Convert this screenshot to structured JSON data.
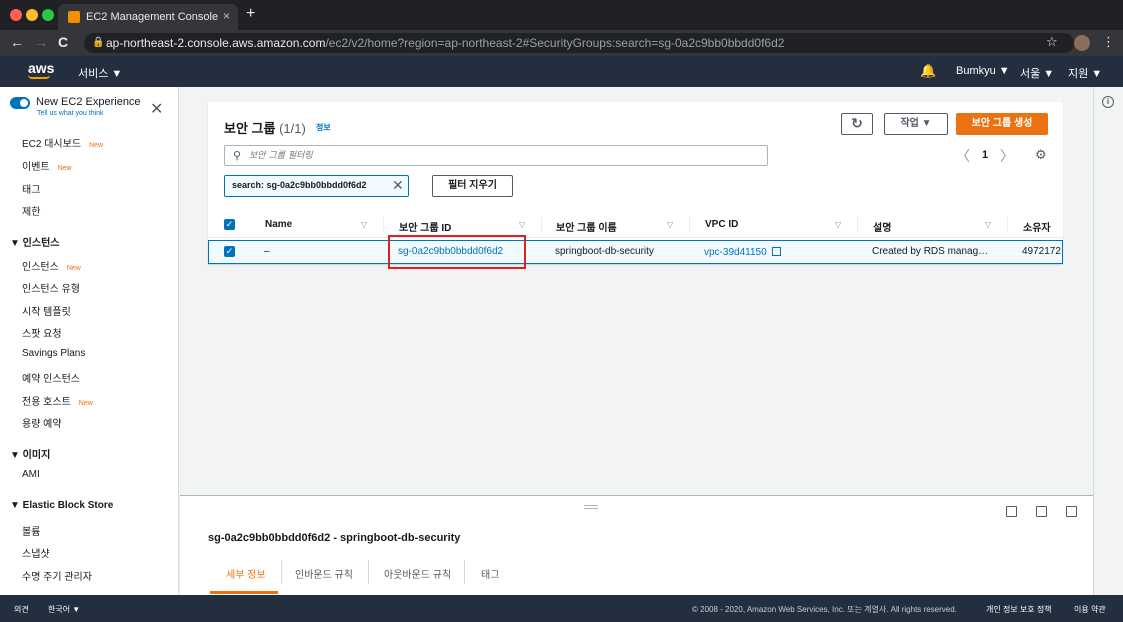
{
  "browser": {
    "tab_title": "EC2 Management Console",
    "tab_close": "×",
    "new_tab": "+",
    "url_host": "ap-northeast-2.console.aws.amazon.com",
    "url_path": "/ec2/v2/home?region=ap-northeast-2#SecurityGroups:search=sg-0a2c9bb0bbdd0f6d2",
    "back": "←",
    "forward": "→",
    "reload": "C",
    "lock": "🔒",
    "star": "☆",
    "menu": "⋮"
  },
  "topnav": {
    "logo": "aws",
    "services": "서비스 ▼",
    "bell": "🔔",
    "user": "Bumkyu ▼",
    "region": "서울 ▼",
    "support": "지원 ▼"
  },
  "sidebar": {
    "new_experience": "New EC2 Experience",
    "tell_us": "Tell us what you think",
    "close": "✕",
    "items": [
      {
        "label": "EC2 대시보드",
        "new": "New"
      },
      {
        "label": "이벤트",
        "new": "New"
      },
      {
        "label": "태그",
        "new": ""
      },
      {
        "label": "제한",
        "new": ""
      }
    ],
    "section_instances": "▼  인스턴스",
    "instances_items": [
      {
        "label": "인스턴스",
        "new": "New"
      },
      {
        "label": "인스턴스 유형",
        "new": ""
      },
      {
        "label": "시작 템플릿",
        "new": ""
      },
      {
        "label": "스팟 요청",
        "new": ""
      },
      {
        "label": "Savings Plans",
        "new": ""
      },
      {
        "label": "예약 인스턴스",
        "new": ""
      },
      {
        "label": "전용 호스트",
        "new": "New"
      },
      {
        "label": "용량 예약",
        "new": ""
      }
    ],
    "section_images": "▼  이미지",
    "images_items": [
      {
        "label": "AMI"
      }
    ],
    "section_ebs": "▼  Elastic Block Store",
    "ebs_items": [
      {
        "label": "볼륨"
      },
      {
        "label": "스냅샷"
      },
      {
        "label": "수명 주기 관리자"
      }
    ]
  },
  "panel": {
    "title": "보안 그룹",
    "count": "(1/1)",
    "info": "정보",
    "refresh": "↻",
    "actions": "작업 ▼",
    "create": "보안 그룹 생성",
    "filter_placeholder": "보안 그룹 필터링",
    "search_icon": "🔍",
    "prev": "〈",
    "page": "1",
    "next": "〉",
    "settings": "⚙",
    "token": "search: sg-0a2c9bb0bbdd0f6d2",
    "token_close": "✕",
    "clear_filters": "필터 지우기"
  },
  "table": {
    "columns": [
      "Name",
      "보안 그룹 ID",
      "보안 그룹 이름",
      "VPC ID",
      "설명",
      "소유자"
    ],
    "sort_icon": "▽",
    "check": "✓",
    "rows": [
      {
        "name": "–",
        "group_id": "sg-0a2c9bb0bbdd0f6d2",
        "group_name": "springboot-db-security",
        "vpc_id": "vpc-39d41150",
        "description": "Created by RDS manag…",
        "owner": "4972172"
      }
    ]
  },
  "split": {
    "title": "sg-0a2c9bb0bbdd0f6d2 - springboot-db-security",
    "tabs": [
      "세부 정보",
      "인바운드 규칙",
      "아웃바운드 규칙",
      "태그"
    ]
  },
  "info_icon": "i",
  "footer": {
    "feedback": "의견",
    "language": "한국어 ▼",
    "copyright": "© 2008 - 2020, Amazon Web Services, Inc. 또는 계열사. All rights reserved.",
    "privacy": "개인 정보 보호 정책",
    "terms": "이용 약관"
  },
  "colors": {
    "accent": "#0073bb",
    "primary": "#ec7211",
    "nav": "#232f3e",
    "highlight": "#e02020"
  }
}
